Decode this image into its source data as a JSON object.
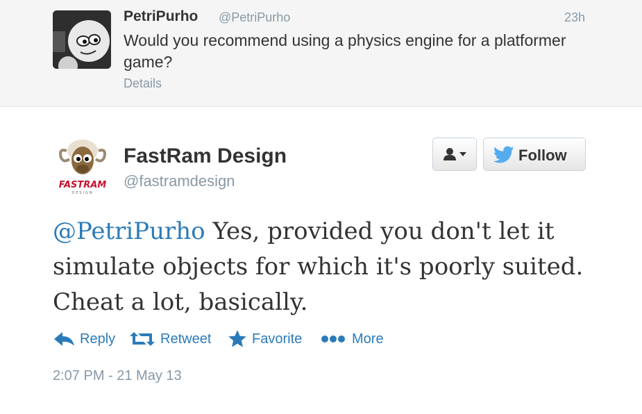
{
  "parent_tweet": {
    "name": "PetriPurho",
    "handle": "@PetriPurho",
    "time": "23h",
    "text": "Would you recommend using a physics engine for a platformer game?",
    "details_label": "Details"
  },
  "main_tweet": {
    "name": "FastRam Design",
    "handle": "@fastramdesign",
    "mention": "@PetriPurho",
    "text": "Yes, provided you don't let it simulate objects for which it's poorly suited. Cheat a lot, basically.",
    "timestamp": "2:07 PM - 21 May 13",
    "logo_text": "FASTRAM",
    "logo_subtext": "DESIGN"
  },
  "buttons": {
    "follow_label": "Follow"
  },
  "actions": {
    "reply": "Reply",
    "retweet": "Retweet",
    "favorite": "Favorite",
    "more": "More"
  },
  "colors": {
    "link": "#2b7bb9",
    "twitter_bird": "#55acee",
    "muted": "#8899a6",
    "parent_bg": "#f5f5f5"
  }
}
